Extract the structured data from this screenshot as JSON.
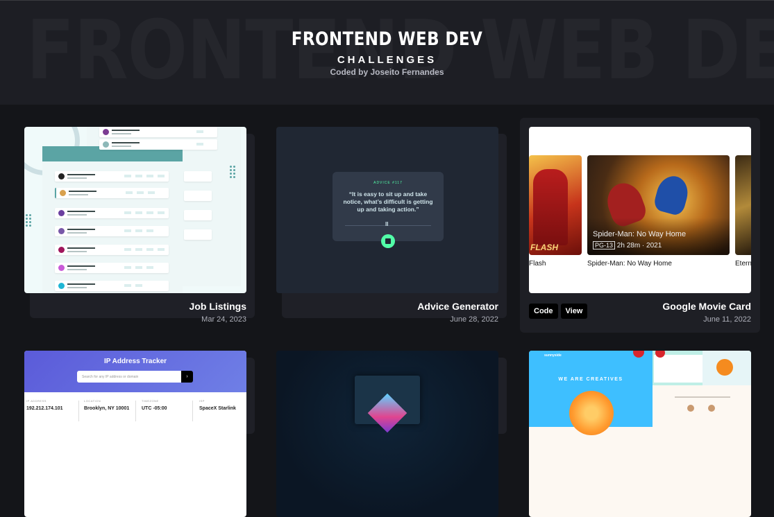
{
  "header": {
    "bg_word": "FRONTEND WEB DEV",
    "title": "FRONTEND WEB DEV",
    "subtitle": "CHALLENGES",
    "credit": "Coded by Joseito Fernandes"
  },
  "cards": [
    {
      "title": "Job Listings",
      "date": "Mar 24, 2023"
    },
    {
      "title": "Advice Generator",
      "date": "June 28, 2022"
    },
    {
      "title": "Google Movie Card",
      "date": "June 11, 2022",
      "code_label": "Code",
      "view_label": "View"
    }
  ],
  "advice_thumb": {
    "number": "ADVICE #117",
    "quote": "“It is easy to sit up and take notice, what’s difficult is getting up and taking action.”",
    "pause": "II"
  },
  "movie_thumb": {
    "items": [
      {
        "label": "Flash",
        "overlay": "FLASH"
      },
      {
        "label": "Spider-Man: No Way Home",
        "overlay_title": "Spider-Man: No Way Home",
        "rating": "PG-13",
        "meta": "2h 28m · 2021"
      },
      {
        "label": "Etern"
      }
    ]
  },
  "ip_thumb": {
    "title": "IP Address Tracker",
    "placeholder": "Search for any IP address or domain",
    "go": "›",
    "columns": [
      {
        "label": "IP ADDRESS",
        "value": "192.212.174.101"
      },
      {
        "label": "LOCATION",
        "value": "Brooklyn, NY 10001"
      },
      {
        "label": "TIMEZONE",
        "value": "UTC -05:00"
      },
      {
        "label": "ISP",
        "value": "SpaceX Starlink"
      }
    ]
  },
  "agency_thumb": {
    "brand": "sunnyside",
    "headline": "WE ARE CREATIVES"
  },
  "colors": {
    "page_bg": "#141519",
    "header_bg": "#1d1e24",
    "teal": "#5ba4a4",
    "advice_green": "#52ffa8",
    "ip_purple": "#5b5bd9",
    "agency_blue": "#3ebfff"
  }
}
